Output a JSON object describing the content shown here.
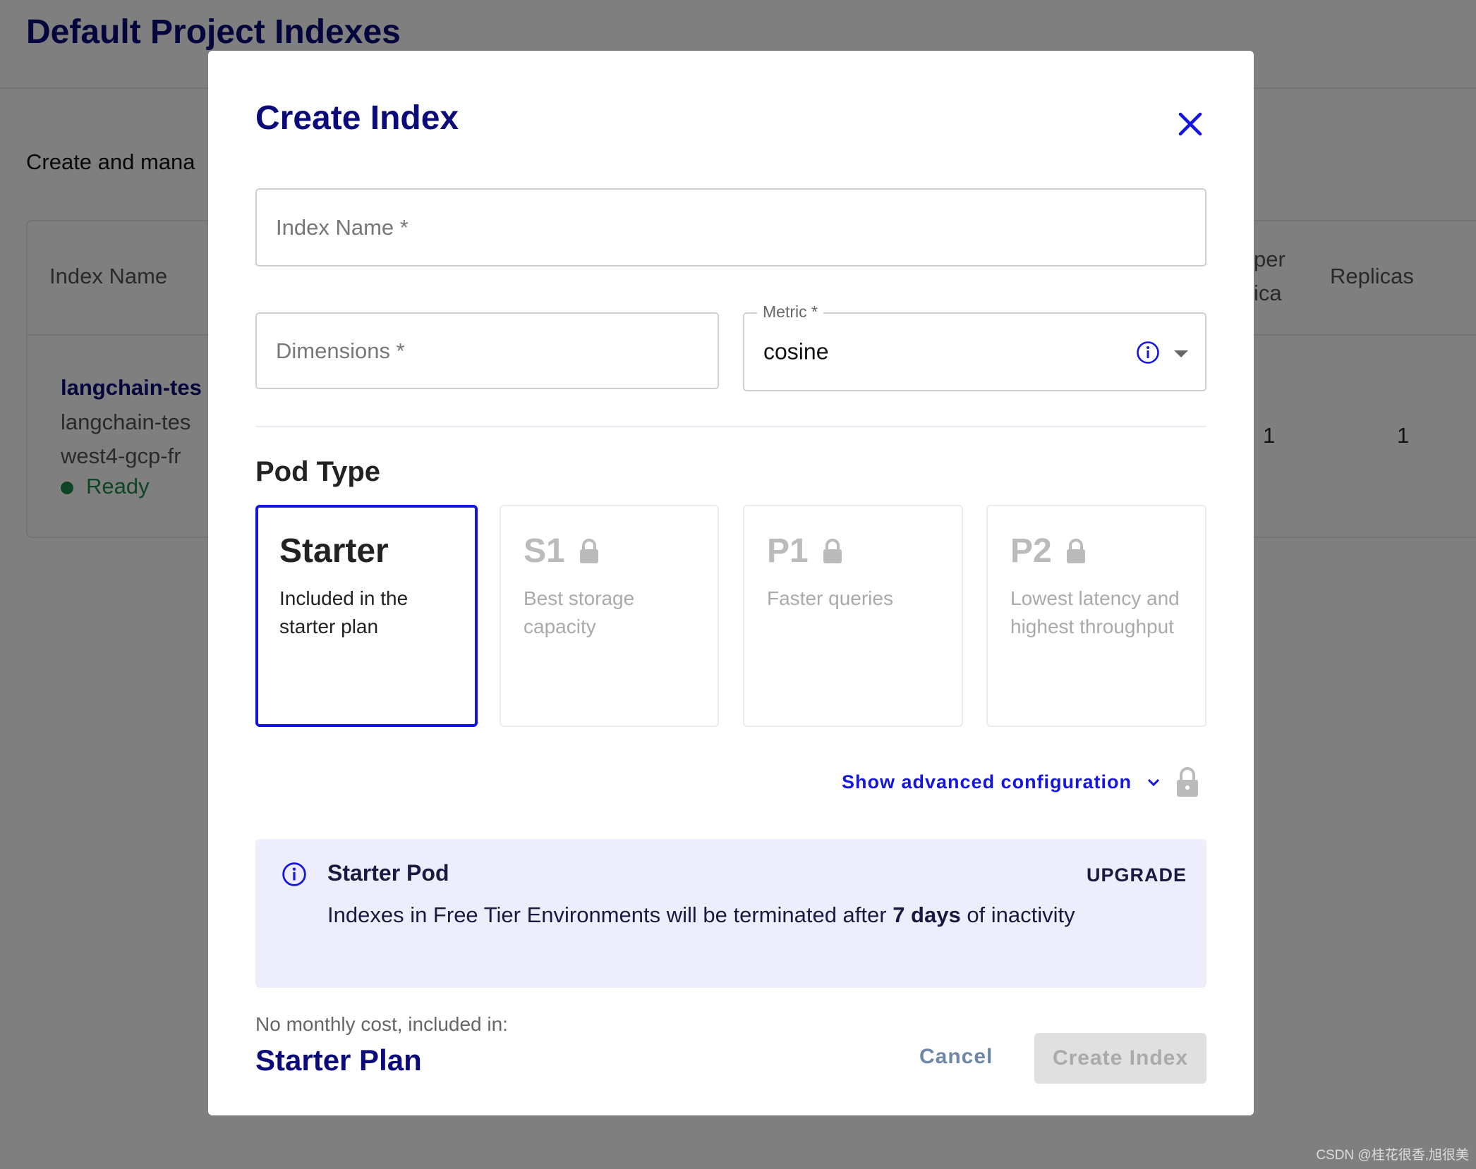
{
  "background": {
    "page_title": "Default Project Indexes",
    "subtitle": "Create and mana",
    "table": {
      "headers": [
        "Index Name",
        "per",
        "ica",
        "Replicas"
      ],
      "row": {
        "name": "langchain-tes",
        "detail_1": "langchain-tes",
        "detail_2": "west4-gcp-fr",
        "status": "Ready",
        "pods_per_replica": "1",
        "replicas": "1"
      }
    }
  },
  "modal": {
    "title": "Create Index",
    "close_icon": "close-icon",
    "index_name_placeholder": "Index Name *",
    "dimensions_placeholder": "Dimensions *",
    "metric_label": "Metric *",
    "metric_value": "cosine",
    "pod_type_heading": "Pod Type",
    "pod_types": [
      {
        "name": "Starter",
        "desc": "Included in the starter plan",
        "selected": true,
        "locked": false
      },
      {
        "name": "S1",
        "desc": "Best storage capacity",
        "selected": false,
        "locked": true
      },
      {
        "name": "P1",
        "desc": "Faster queries",
        "selected": false,
        "locked": true
      },
      {
        "name": "P2",
        "desc": "Lowest latency and highest throughput",
        "selected": false,
        "locked": true
      }
    ],
    "advanced_label": "Show advanced configuration",
    "info": {
      "title": "Starter Pod",
      "body_before": "Indexes in Free Tier Environments will be terminated after ",
      "body_bold": "7 days",
      "body_after": " of inactivity",
      "upgrade_label": "UPGRADE"
    },
    "cost_label": "No monthly cost, included in:",
    "plan_name": "Starter Plan",
    "cancel_label": "Cancel",
    "create_label": "Create Index"
  },
  "watermark": "CSDN @桂花很香,旭很美",
  "colors": {
    "accent": "#1515e0",
    "navy": "#0b0a7a",
    "ready": "#1d8a4c",
    "info_bg": "#ededfc"
  }
}
